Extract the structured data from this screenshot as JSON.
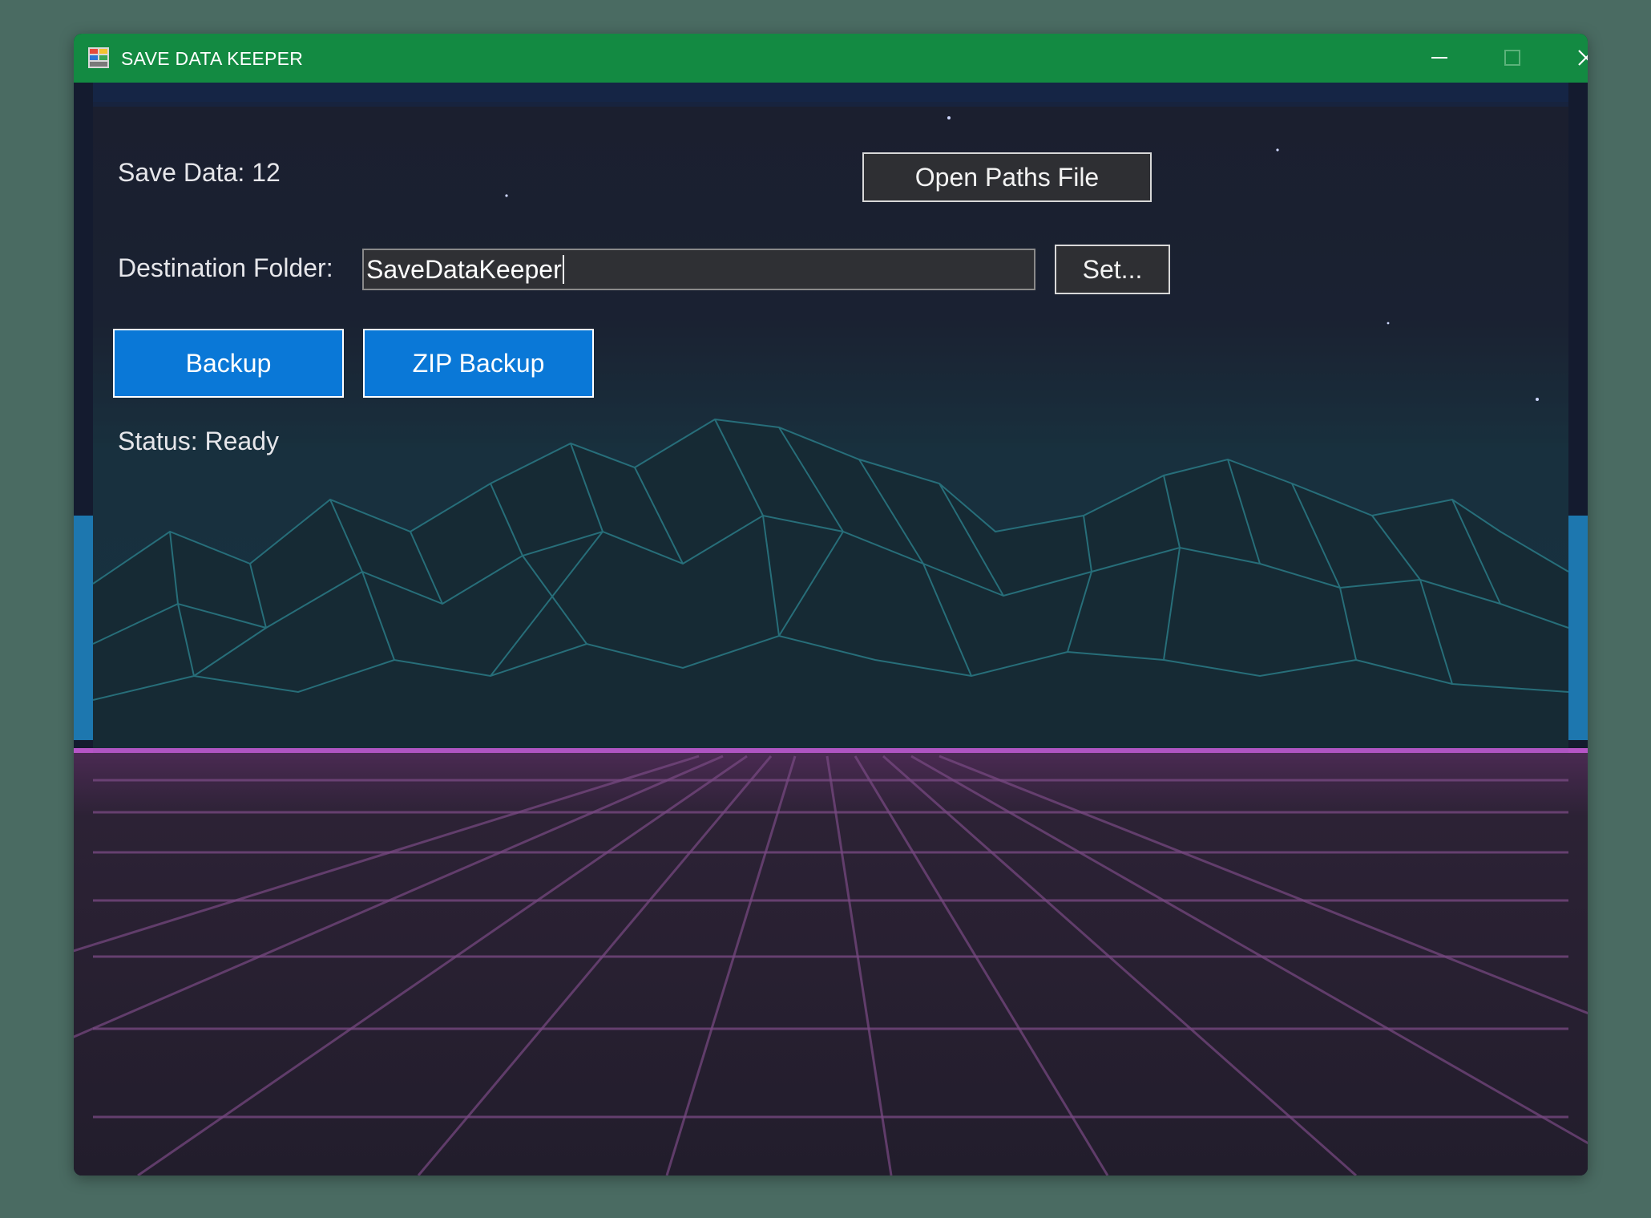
{
  "window": {
    "title": "SAVE DATA KEEPER"
  },
  "content": {
    "save_data_label": "Save Data: 12",
    "open_paths_button": "Open Paths File",
    "destination_label": "Destination Folder:",
    "destination_value": "SaveDataKeeper",
    "set_button": "Set...",
    "backup_button": "Backup",
    "zip_backup_button": "ZIP Backup",
    "status_label": "Status: Ready"
  },
  "colors": {
    "titlebar": "#138a42",
    "accent_button": "#0a78d7",
    "desktop": "#4a6b62"
  }
}
